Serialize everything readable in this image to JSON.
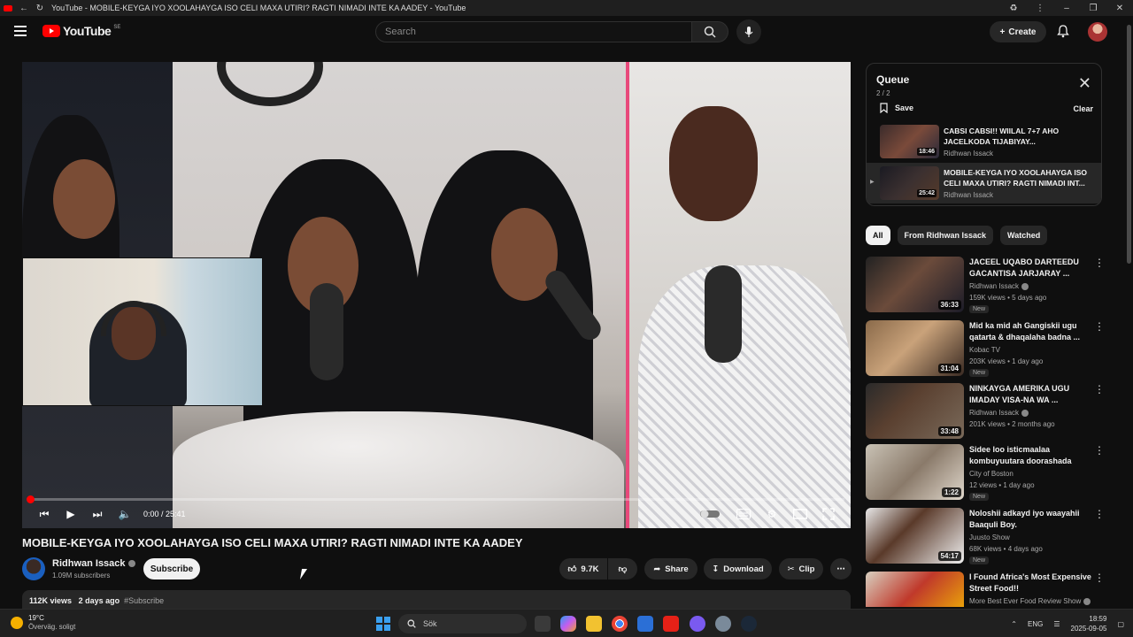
{
  "browser": {
    "tab_title": "YouTube - MOBILE-KEYGA IYO XOOLAHAYGA ISO CELI MAXA UTIRI? RAGTI NIMADI INTE KA AADEY - YouTube"
  },
  "masthead": {
    "logo_text": "YouTube",
    "country_code": "SE",
    "search_placeholder": "Search",
    "create_label": "Create"
  },
  "player": {
    "time": "0:00 / 25:41",
    "progress_fraction": 0.0
  },
  "video": {
    "title": "MOBILE-KEYGA IYO XOOLAHAYGA ISO CELI MAXA UTIRI? RAGTI NIMADI INTE KA AADEY",
    "channel_name": "Ridhwan Issack",
    "subscribers": "1.09M subscribers",
    "subscribe_label": "Subscribe",
    "likes": "9.7K",
    "share_label": "Share",
    "download_label": "Download",
    "clip_label": "Clip",
    "views": "112K views",
    "posted": "2 days ago",
    "hashtag": "#Subscribe"
  },
  "queue": {
    "title": "Queue",
    "count": "2 / 2",
    "save_label": "Save",
    "clear_label": "Clear",
    "items": [
      {
        "title": "CABSI CABSI!! WIILAL 7+7 AHO JACELKODA TIJABIYAY...",
        "channel": "Ridhwan Issack",
        "duration": "18:46"
      },
      {
        "title": "MOBILE-KEYGA IYO XOOLAHAYGA ISO CELI MAXA UTIRI? RAGTI NIMADI INT...",
        "channel": "Ridhwan Issack",
        "duration": "25:42"
      }
    ]
  },
  "chips": [
    "All",
    "From Ridhwan Issack",
    "Watched"
  ],
  "recommendations": [
    {
      "title": "JACEEL UQABO DARTEEDU GACANTISA JARJARAY ...",
      "channel": "Ridhwan Issack",
      "meta": "159K views • 5 days ago",
      "badge": "New",
      "duration": "36:33"
    },
    {
      "title": "Mid ka mid ah Gangiskii ugu qatarta & dhaqalaha badna ...",
      "channel": "Kobac TV",
      "meta": "203K views • 1 day ago",
      "badge": "New",
      "duration": "31:04"
    },
    {
      "title": "NINKAYGA AMERIKA UGU IMADAY VISA-NA WA ...",
      "channel": "Ridhwan Issack",
      "meta": "201K views • 2 months ago",
      "badge": "",
      "duration": "33:48"
    },
    {
      "title": "Sidee loo isticmaalaa kombuyuutara doorashada",
      "channel": "City of Boston",
      "meta": "12 views • 1 day ago",
      "badge": "New",
      "duration": "1:22"
    },
    {
      "title": "Noloshii adkayd iyo waayahii Baaquli Boy.",
      "channel": "Juusto Show",
      "meta": "68K views • 4 days ago",
      "badge": "New",
      "duration": "54:17"
    },
    {
      "title": "I Found Africa's Most Expensive Street Food!!",
      "channel": "More Best Ever Food Review Show",
      "meta": "",
      "badge": "",
      "duration": ""
    }
  ],
  "taskbar": {
    "temperature": "19°C",
    "weather": "Överväg. soligt",
    "search_label": "Sök",
    "language": "ENG",
    "time": "18:59",
    "date": "2025-09-05"
  }
}
